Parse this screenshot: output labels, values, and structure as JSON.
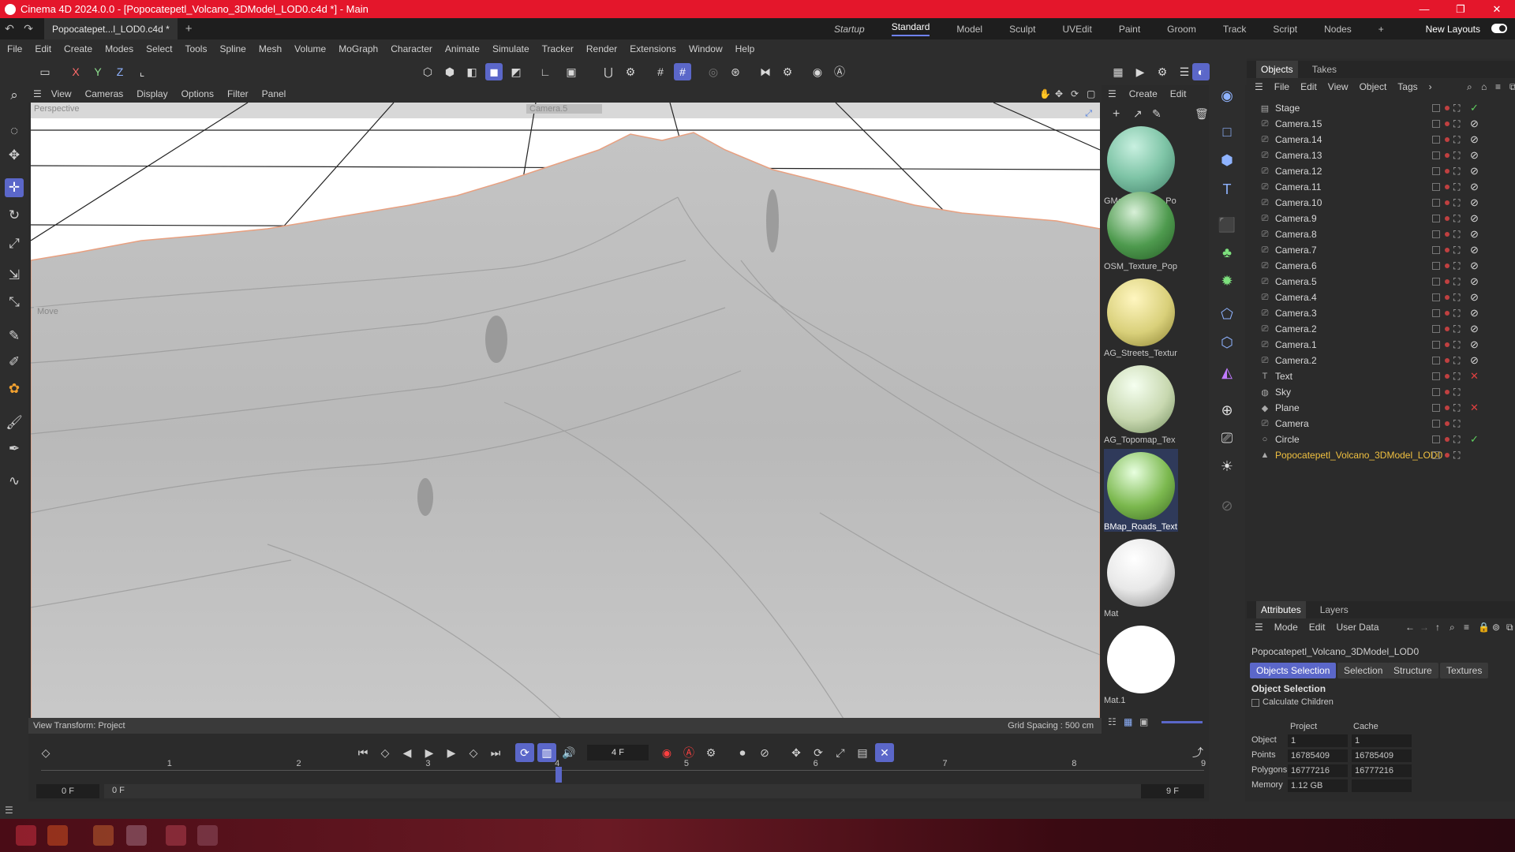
{
  "window": {
    "title": "Cinema 4D 2024.0.0 - [Popocatepetl_Volcano_3DModel_LOD0.c4d *] - Main"
  },
  "tabs": {
    "doc_tab": "Popocatepet...l_LOD0.c4d *"
  },
  "layouts": {
    "items": [
      "Startup",
      "Standard",
      "Model",
      "Sculpt",
      "UVEdit",
      "Paint",
      "Groom",
      "Track",
      "Script",
      "Nodes"
    ],
    "active": "Standard",
    "new_layouts": "New Layouts"
  },
  "menu": [
    "File",
    "Edit",
    "Create",
    "Modes",
    "Select",
    "Tools",
    "Spline",
    "Mesh",
    "Volume",
    "MoGraph",
    "Character",
    "Animate",
    "Simulate",
    "Tracker",
    "Render",
    "Extensions",
    "Window",
    "Help"
  ],
  "axis_toggles": {
    "x": "X",
    "y": "Y",
    "z": "Z"
  },
  "viewport": {
    "menu": [
      "View",
      "Cameras",
      "Display",
      "Options",
      "Filter",
      "Panel"
    ],
    "perspective_label": "Perspective",
    "camera_label": "Camera.5",
    "tool_label": "Move",
    "view_transform": "View Transform: Project",
    "grid_spacing": "Grid Spacing : 500 cm"
  },
  "materials": {
    "menu": [
      "Create",
      "Edit"
    ],
    "items": [
      {
        "name": "GMap_Texture_Po",
        "color": "#7ec4a6"
      },
      {
        "name": "OSM_Texture_Pop",
        "color": "#4e9a4e"
      },
      {
        "name": "AG_Streets_Textur",
        "color": "#d9d07a"
      },
      {
        "name": "AG_Topomap_Tex",
        "color": "#c8d8b0"
      },
      {
        "name": "BMap_Roads_Text",
        "color": "#7bb84e"
      },
      {
        "name": "Mat",
        "color": "#e8e8e8"
      },
      {
        "name": "Mat.1",
        "color": "#ffffff"
      }
    ],
    "selected": "BMap_Roads_Text"
  },
  "objects_panel": {
    "tabs": [
      "Objects",
      "Takes"
    ],
    "active_tab": "Objects",
    "menu": [
      "File",
      "Edit",
      "View",
      "Object",
      "Tags"
    ],
    "rows": [
      {
        "name": "Stage",
        "icon": "stage-icon",
        "tag": "✓"
      },
      {
        "name": "Camera.15",
        "icon": "camera-icon",
        "tag": "⊘"
      },
      {
        "name": "Camera.14",
        "icon": "camera-icon",
        "tag": "⊘"
      },
      {
        "name": "Camera.13",
        "icon": "camera-icon",
        "tag": "⊘"
      },
      {
        "name": "Camera.12",
        "icon": "camera-icon",
        "tag": "⊘"
      },
      {
        "name": "Camera.11",
        "icon": "camera-icon",
        "tag": "⊘"
      },
      {
        "name": "Camera.10",
        "icon": "camera-icon",
        "tag": "⊘"
      },
      {
        "name": "Camera.9",
        "icon": "camera-icon",
        "tag": "⊘"
      },
      {
        "name": "Camera.8",
        "icon": "camera-icon",
        "tag": "⊘"
      },
      {
        "name": "Camera.7",
        "icon": "camera-icon",
        "tag": "⊘"
      },
      {
        "name": "Camera.6",
        "icon": "camera-icon",
        "tag": "⊘"
      },
      {
        "name": "Camera.5",
        "icon": "camera-icon",
        "tag": "⊘"
      },
      {
        "name": "Camera.4",
        "icon": "camera-icon",
        "tag": "⊘"
      },
      {
        "name": "Camera.3",
        "icon": "camera-icon",
        "tag": "⊘"
      },
      {
        "name": "Camera.2",
        "icon": "camera-icon",
        "tag": "⊘"
      },
      {
        "name": "Camera.1",
        "icon": "camera-icon",
        "tag": "⊘"
      },
      {
        "name": "Camera.2",
        "icon": "camera-icon",
        "tag": "⊘"
      },
      {
        "name": "Text",
        "icon": "text-icon",
        "tag": "✕"
      },
      {
        "name": "Sky",
        "icon": "sky-icon",
        "tag": ""
      },
      {
        "name": "Plane",
        "icon": "plane-icon",
        "tag": "✕"
      },
      {
        "name": "Camera",
        "icon": "camera-icon",
        "tag": ""
      },
      {
        "name": "Circle",
        "icon": "circle-icon",
        "tag": "✓"
      },
      {
        "name": "Popocatepetl_Volcano_3DModel_LOD0",
        "icon": "polygon-icon",
        "tag": "",
        "highlight": true
      }
    ]
  },
  "attributes": {
    "tabs": [
      "Attributes",
      "Layers"
    ],
    "active_tab": "Attributes",
    "menu": [
      "Mode",
      "Edit",
      "User Data"
    ],
    "object_name": "Popocatepetl_Volcano_3DModel_LOD0",
    "subtabs": [
      "Objects Selection",
      "Selection",
      "Structure",
      "Textures"
    ],
    "active_subtab": "Objects Selection",
    "section_title": "Object Selection",
    "calc_children": "Calculate Children",
    "col_project": "Project",
    "col_cache": "Cache",
    "rows": [
      {
        "label": "Object",
        "project": "1",
        "cache": "1"
      },
      {
        "label": "Points",
        "project": "16785409",
        "cache": "16785409"
      },
      {
        "label": "Polygons",
        "project": "16777216",
        "cache": "16777216"
      },
      {
        "label": "Memory",
        "project": "1.12 GB",
        "cache": ""
      }
    ]
  },
  "timeline": {
    "current_frame": "4 F",
    "ticks": [
      "1",
      "2",
      "3",
      "4",
      "5",
      "6",
      "7",
      "8",
      "9"
    ],
    "start": "0 F",
    "start2": "0 F",
    "end": "9 F",
    "end2": "9 F"
  },
  "colors": {
    "accent": "#5b67c9",
    "titlebar": "#e4162b",
    "highlight_text": "#f0c040"
  }
}
